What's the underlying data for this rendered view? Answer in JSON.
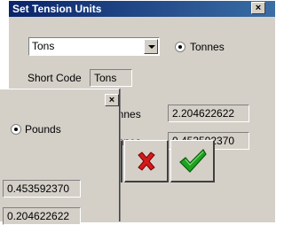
{
  "main_dialog": {
    "title": "Set Tension Units",
    "close_glyph": "×",
    "unit_select_value": "Tons",
    "radio_tonnes_label": "Tonnes",
    "short_code_label": "Short Code",
    "short_code_value": "Tons",
    "row1_label": "onnes",
    "row1_value": "2.204622622",
    "row2_label": "onnes",
    "row2_value": "0.453592370",
    "cancel_icon": "red-x-icon",
    "ok_icon": "green-check-icon"
  },
  "small_dialog": {
    "close_glyph": "×",
    "radio_pounds_label": "Pounds",
    "value1": "0.453592370",
    "value2": "0.204622622"
  },
  "colors": {
    "dialog_bg": "#d4d0c8",
    "title_start": "#0a246a",
    "title_end": "#3a6ea5",
    "cancel_red": "#d21a1a",
    "ok_green": "#1fa31f"
  }
}
